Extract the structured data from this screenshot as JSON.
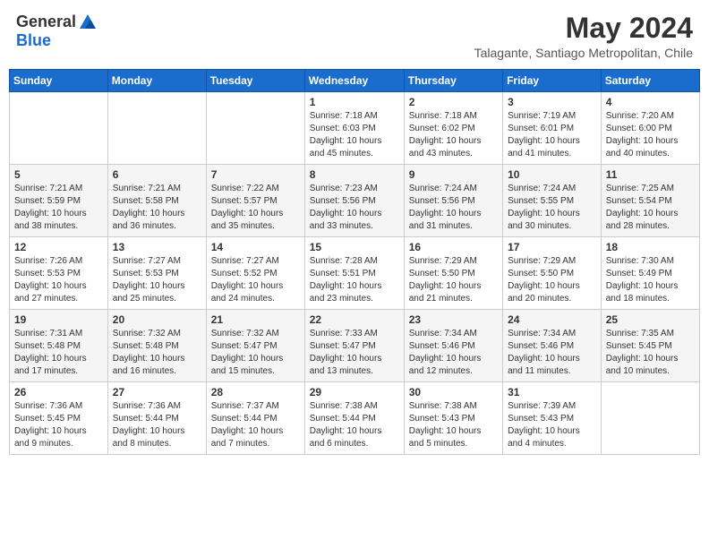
{
  "header": {
    "logo_general": "General",
    "logo_blue": "Blue",
    "month_year": "May 2024",
    "location": "Talagante, Santiago Metropolitan, Chile"
  },
  "weekdays": [
    "Sunday",
    "Monday",
    "Tuesday",
    "Wednesday",
    "Thursday",
    "Friday",
    "Saturday"
  ],
  "weeks": [
    [
      {
        "day": "",
        "info": ""
      },
      {
        "day": "",
        "info": ""
      },
      {
        "day": "",
        "info": ""
      },
      {
        "day": "1",
        "info": "Sunrise: 7:18 AM\nSunset: 6:03 PM\nDaylight: 10 hours\nand 45 minutes."
      },
      {
        "day": "2",
        "info": "Sunrise: 7:18 AM\nSunset: 6:02 PM\nDaylight: 10 hours\nand 43 minutes."
      },
      {
        "day": "3",
        "info": "Sunrise: 7:19 AM\nSunset: 6:01 PM\nDaylight: 10 hours\nand 41 minutes."
      },
      {
        "day": "4",
        "info": "Sunrise: 7:20 AM\nSunset: 6:00 PM\nDaylight: 10 hours\nand 40 minutes."
      }
    ],
    [
      {
        "day": "5",
        "info": "Sunrise: 7:21 AM\nSunset: 5:59 PM\nDaylight: 10 hours\nand 38 minutes."
      },
      {
        "day": "6",
        "info": "Sunrise: 7:21 AM\nSunset: 5:58 PM\nDaylight: 10 hours\nand 36 minutes."
      },
      {
        "day": "7",
        "info": "Sunrise: 7:22 AM\nSunset: 5:57 PM\nDaylight: 10 hours\nand 35 minutes."
      },
      {
        "day": "8",
        "info": "Sunrise: 7:23 AM\nSunset: 5:56 PM\nDaylight: 10 hours\nand 33 minutes."
      },
      {
        "day": "9",
        "info": "Sunrise: 7:24 AM\nSunset: 5:56 PM\nDaylight: 10 hours\nand 31 minutes."
      },
      {
        "day": "10",
        "info": "Sunrise: 7:24 AM\nSunset: 5:55 PM\nDaylight: 10 hours\nand 30 minutes."
      },
      {
        "day": "11",
        "info": "Sunrise: 7:25 AM\nSunset: 5:54 PM\nDaylight: 10 hours\nand 28 minutes."
      }
    ],
    [
      {
        "day": "12",
        "info": "Sunrise: 7:26 AM\nSunset: 5:53 PM\nDaylight: 10 hours\nand 27 minutes."
      },
      {
        "day": "13",
        "info": "Sunrise: 7:27 AM\nSunset: 5:53 PM\nDaylight: 10 hours\nand 25 minutes."
      },
      {
        "day": "14",
        "info": "Sunrise: 7:27 AM\nSunset: 5:52 PM\nDaylight: 10 hours\nand 24 minutes."
      },
      {
        "day": "15",
        "info": "Sunrise: 7:28 AM\nSunset: 5:51 PM\nDaylight: 10 hours\nand 23 minutes."
      },
      {
        "day": "16",
        "info": "Sunrise: 7:29 AM\nSunset: 5:50 PM\nDaylight: 10 hours\nand 21 minutes."
      },
      {
        "day": "17",
        "info": "Sunrise: 7:29 AM\nSunset: 5:50 PM\nDaylight: 10 hours\nand 20 minutes."
      },
      {
        "day": "18",
        "info": "Sunrise: 7:30 AM\nSunset: 5:49 PM\nDaylight: 10 hours\nand 18 minutes."
      }
    ],
    [
      {
        "day": "19",
        "info": "Sunrise: 7:31 AM\nSunset: 5:48 PM\nDaylight: 10 hours\nand 17 minutes."
      },
      {
        "day": "20",
        "info": "Sunrise: 7:32 AM\nSunset: 5:48 PM\nDaylight: 10 hours\nand 16 minutes."
      },
      {
        "day": "21",
        "info": "Sunrise: 7:32 AM\nSunset: 5:47 PM\nDaylight: 10 hours\nand 15 minutes."
      },
      {
        "day": "22",
        "info": "Sunrise: 7:33 AM\nSunset: 5:47 PM\nDaylight: 10 hours\nand 13 minutes."
      },
      {
        "day": "23",
        "info": "Sunrise: 7:34 AM\nSunset: 5:46 PM\nDaylight: 10 hours\nand 12 minutes."
      },
      {
        "day": "24",
        "info": "Sunrise: 7:34 AM\nSunset: 5:46 PM\nDaylight: 10 hours\nand 11 minutes."
      },
      {
        "day": "25",
        "info": "Sunrise: 7:35 AM\nSunset: 5:45 PM\nDaylight: 10 hours\nand 10 minutes."
      }
    ],
    [
      {
        "day": "26",
        "info": "Sunrise: 7:36 AM\nSunset: 5:45 PM\nDaylight: 10 hours\nand 9 minutes."
      },
      {
        "day": "27",
        "info": "Sunrise: 7:36 AM\nSunset: 5:44 PM\nDaylight: 10 hours\nand 8 minutes."
      },
      {
        "day": "28",
        "info": "Sunrise: 7:37 AM\nSunset: 5:44 PM\nDaylight: 10 hours\nand 7 minutes."
      },
      {
        "day": "29",
        "info": "Sunrise: 7:38 AM\nSunset: 5:44 PM\nDaylight: 10 hours\nand 6 minutes."
      },
      {
        "day": "30",
        "info": "Sunrise: 7:38 AM\nSunset: 5:43 PM\nDaylight: 10 hours\nand 5 minutes."
      },
      {
        "day": "31",
        "info": "Sunrise: 7:39 AM\nSunset: 5:43 PM\nDaylight: 10 hours\nand 4 minutes."
      },
      {
        "day": "",
        "info": ""
      }
    ]
  ]
}
